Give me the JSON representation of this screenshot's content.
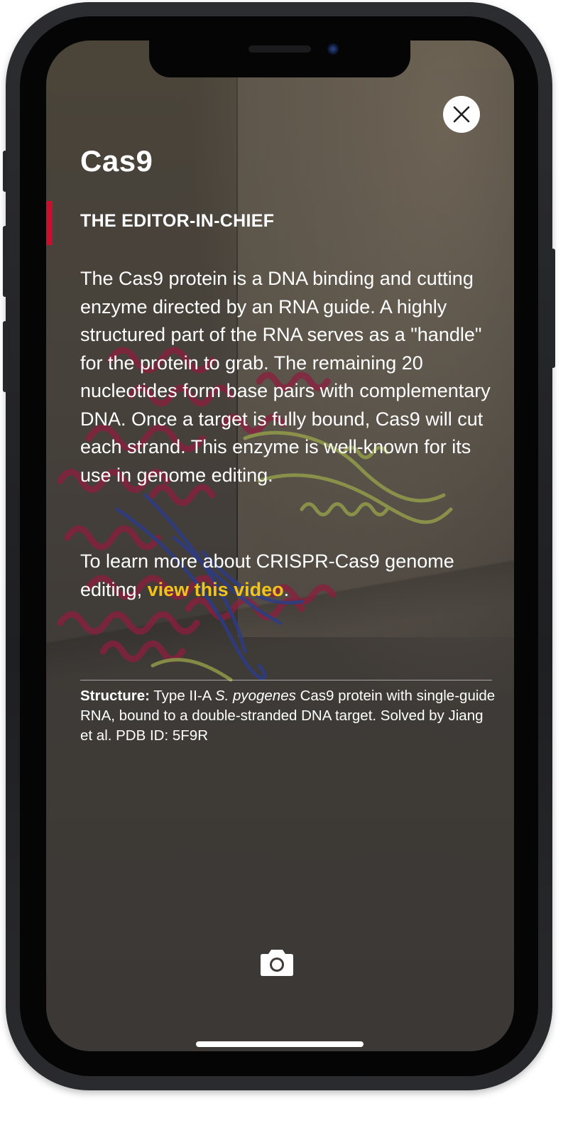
{
  "card": {
    "title": "Cas9",
    "subtitle": "THE EDITOR-IN-CHIEF",
    "description": "The Cas9 protein is a DNA binding and cutting enzyme directed by an RNA guide. A highly structured part of the RNA serves as a \"handle\" for the protein to grab. The remaining 20 nucleotides form base pairs with complementary DNA. Once a target is fully bound, Cas9 will cut each strand. This enzyme is well-known for its use in genome editing.",
    "learn_more_prefix": "To learn more about CRISPR-Cas9 genome editing, ",
    "learn_more_link": "view this video",
    "learn_more_suffix": ".",
    "caption_label": "Structure:",
    "caption_part1": " Type II-A ",
    "caption_species": "S. pyogenes",
    "caption_part2": " Cas9 protein with single-guide RNA, bound to a double-stranded DNA target. Solved by Jiang et al. PDB ID: 5F9R"
  },
  "icons": {
    "close": "close-icon",
    "camera": "camera-icon"
  },
  "colors": {
    "accent_bar": "#c8102e",
    "link": "#f2c31a",
    "protein": "#8c1f3f",
    "rna": "#9aa64a",
    "dna": "#2b3b8f"
  }
}
